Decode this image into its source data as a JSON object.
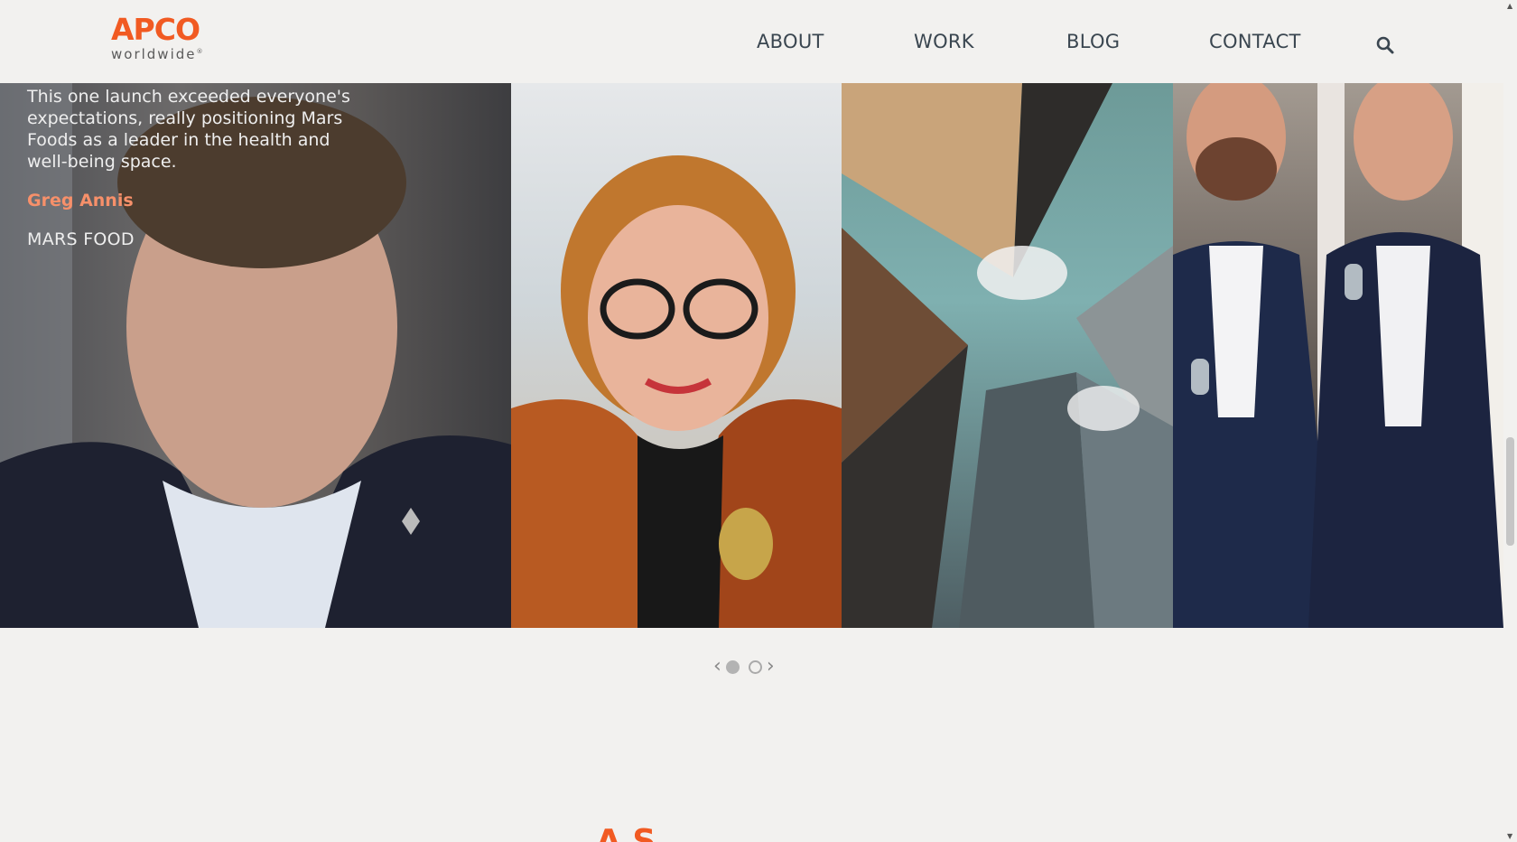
{
  "header": {
    "logo_main": "APCO",
    "logo_sub": "worldwide",
    "logo_reg": "®",
    "nav": {
      "about": "ABOUT",
      "work": "WORK",
      "blog": "BLOG",
      "contact": "CONTACT"
    },
    "search_icon": "search-icon"
  },
  "carousel": {
    "quote": "This one launch exceeded everyone's expectations, really positioning Mars Foods as a leader in the health and well-being space.",
    "author": "Greg Annis",
    "company": "MARS FOOD",
    "panels": [
      "man-portrait",
      "woman-portrait",
      "skyscrapers-photo",
      "two-men-photo"
    ],
    "active_slide": 1,
    "slide_count": 2,
    "prev_icon": "chevron-left-icon",
    "next_icon": "chevron-right-icon"
  },
  "section_heading_partial": "A          S",
  "colors": {
    "brand": "#f15a22",
    "author": "#f7906a",
    "nav": "#3a4650",
    "background": "#f2f1ef"
  }
}
